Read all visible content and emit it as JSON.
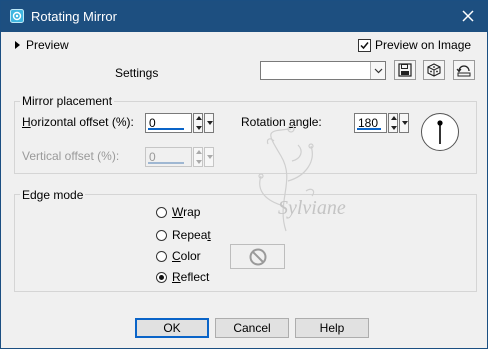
{
  "window": {
    "title": "Rotating Mirror"
  },
  "preview": {
    "label": "Preview",
    "checkbox_label": "Preview on Image",
    "checkbox_checked": true
  },
  "settings": {
    "label": "Settings",
    "value": ""
  },
  "mirror": {
    "group_label": "Mirror placement",
    "horizontal_label_pre": "H",
    "horizontal_label_post": "orizontal offset (%):",
    "horizontal_value": "0",
    "vertical_label": "Vertical offset (%):",
    "vertical_value": "0",
    "rotation_label_pre": "Rotation ",
    "rotation_label_u": "a",
    "rotation_label_post": "ngle:",
    "rotation_value": "180"
  },
  "edge": {
    "group_label": "Edge mode",
    "options": [
      {
        "pre": "",
        "u": "W",
        "post": "rap",
        "selected": false
      },
      {
        "pre": "Repea",
        "u": "t",
        "post": "",
        "selected": false
      },
      {
        "pre": "",
        "u": "C",
        "post": "olor",
        "selected": false
      },
      {
        "pre": "",
        "u": "R",
        "post": "eflect",
        "selected": true
      }
    ]
  },
  "watermark": {
    "text": "Sylviane"
  },
  "buttons": {
    "ok": "OK",
    "cancel": "Cancel",
    "help": "Help"
  },
  "colors": {
    "titlebar": "#1d4f80",
    "accent": "#0a64c8"
  }
}
